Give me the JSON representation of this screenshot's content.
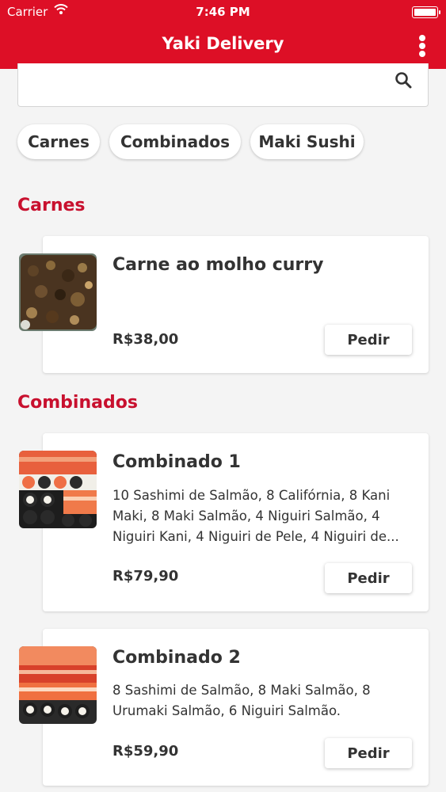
{
  "status_bar": {
    "carrier": "Carrier",
    "time": "7:46 PM"
  },
  "header": {
    "title": "Yaki Delivery"
  },
  "search": {
    "placeholder": ""
  },
  "categories": [
    "Carnes",
    "Combinados",
    "Maki Sushi"
  ],
  "sections": [
    {
      "title": "Carnes",
      "items": [
        {
          "name": "Carne ao molho curry",
          "description": "",
          "price": "R$38,00",
          "button": "Pedir"
        }
      ]
    },
    {
      "title": "Combinados",
      "items": [
        {
          "name": "Combinado 1",
          "description_lines": [
            "10 Sashimi de Salmão, 8 Califórnia, 8 Kani",
            "Maki, 8 Maki Salmão, 4 Niguiri Salmão, 4",
            "Niguiri Kani, 4 Niguiri de Pele, 4 Niguiri de..."
          ],
          "price": "R$79,90",
          "button": "Pedir"
        },
        {
          "name": "Combinado 2",
          "description_lines": [
            "8 Sashimi de Salmão, 8 Maki Salmão, 8",
            "Urumaki Salmão, 6 Niguiri Salmão."
          ],
          "price": "R$59,90",
          "button": "Pedir"
        }
      ]
    }
  ],
  "colors": {
    "primary": "#dd0f26",
    "section_title": "#c8102e",
    "background": "#f4f4f4"
  },
  "icons": {
    "search": "search-icon",
    "menu": "more-vertical-icon",
    "wifi": "wifi-icon",
    "battery": "battery-icon"
  }
}
